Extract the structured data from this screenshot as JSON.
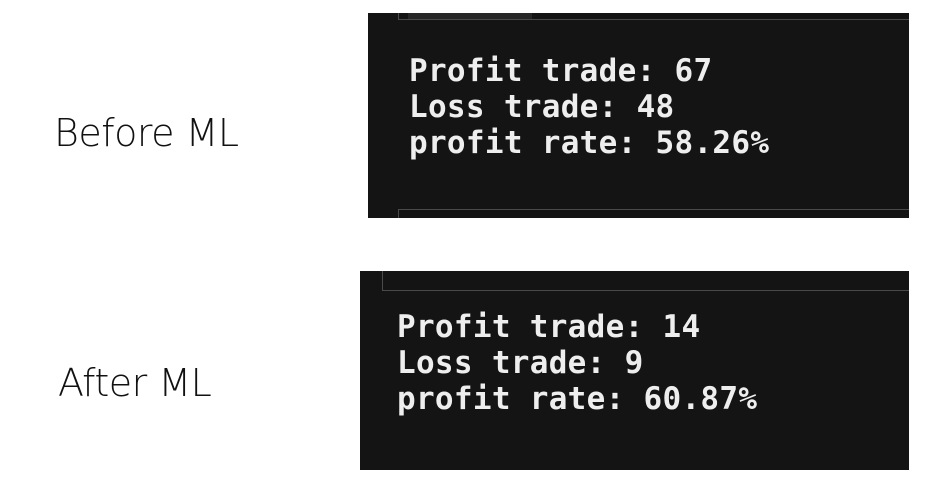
{
  "comparisons": [
    {
      "label": "Before ML",
      "terminal": {
        "lines": [
          "Profit trade: 67",
          "Loss trade: 48",
          "profit rate: 58.26%"
        ]
      }
    },
    {
      "label": "After ML",
      "terminal": {
        "lines": [
          "Profit trade: 14",
          "Loss trade: 9",
          "profit rate: 60.87%"
        ]
      }
    }
  ],
  "colors": {
    "page_background": "#ffffff",
    "label_text": "#111111",
    "terminal_background": "#141414",
    "terminal_text": "#eeeeee",
    "pane_border": "#4a4a4a"
  }
}
